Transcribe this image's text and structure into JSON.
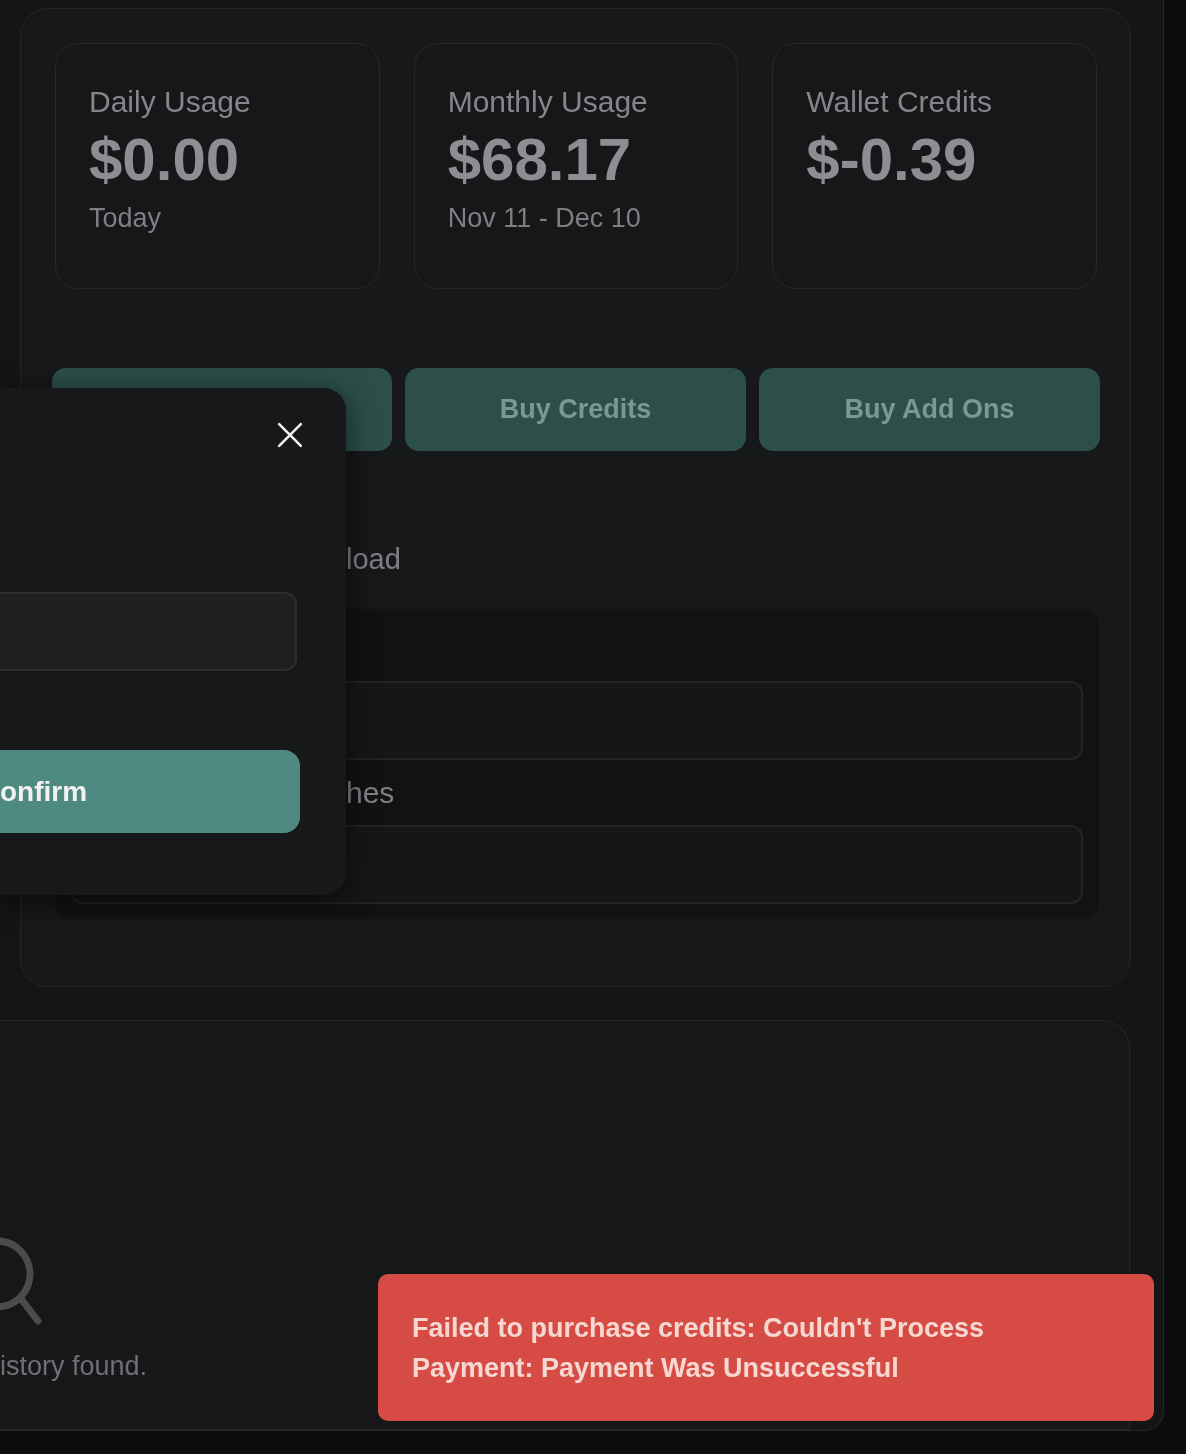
{
  "stats": [
    {
      "label": "Daily Usage",
      "value": "$0.00",
      "caption": "Today"
    },
    {
      "label": "Monthly Usage",
      "value": "$68.17",
      "caption": "Nov 11 - Dec 10"
    },
    {
      "label": "Wallet Credits",
      "value": "$-0.39"
    }
  ],
  "actions": [
    "Buy Credits",
    "Buy Add Ons"
  ],
  "settings": {
    "section_label": "load",
    "field_label": "hes"
  },
  "modal": {
    "confirm_label": "onfirm"
  },
  "history": {
    "empty_text": "istory found."
  },
  "toast": {
    "kind": "error",
    "message": "Failed to purchase credits: Couldn't Process Payment: Payment Was Unsuccessful"
  }
}
